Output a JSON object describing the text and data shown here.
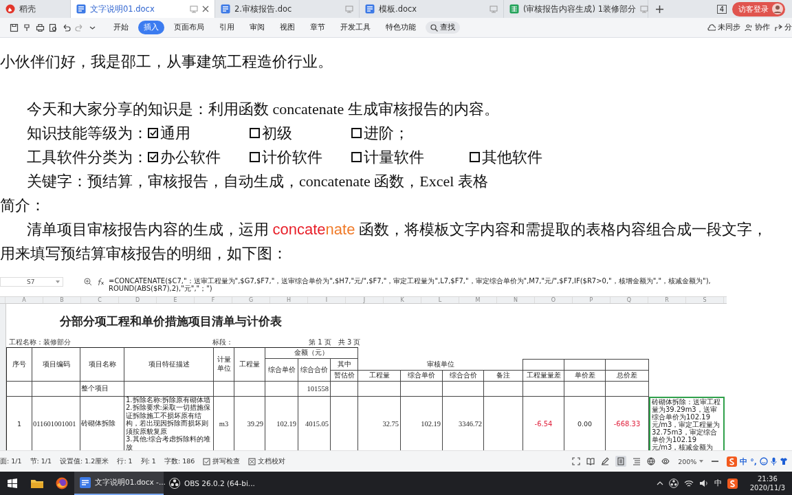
{
  "tabs": [
    {
      "label": "稻壳",
      "kind": "home",
      "selected": false
    },
    {
      "label": "文字说明01.docx",
      "kind": "doc",
      "selected": true
    },
    {
      "label": "2.审核报告.doc",
      "kind": "doc",
      "selected": false
    },
    {
      "label": "模板.docx",
      "kind": "doc",
      "selected": false
    },
    {
      "label": "(审核报告内容生成) 1装修部分",
      "kind": "sheet",
      "selected": false
    }
  ],
  "window_count": "4",
  "login": "访客登录",
  "menu": [
    {
      "label": "开始",
      "selected": false
    },
    {
      "label": "插入",
      "selected": true
    },
    {
      "label": "页面布局",
      "selected": false
    },
    {
      "label": "引用",
      "selected": false
    },
    {
      "label": "审阅",
      "selected": false
    },
    {
      "label": "视图",
      "selected": false
    },
    {
      "label": "章节",
      "selected": false
    },
    {
      "label": "开发工具",
      "selected": false
    },
    {
      "label": "特色功能",
      "selected": false
    }
  ],
  "search": "查找",
  "toolbar_right": [
    "未同步",
    "协作",
    "分"
  ],
  "document": [
    {
      "kind": "text",
      "indent": false,
      "segments": [
        {
          "text": "小伙伴们好，我是邵工，从事建筑工程造价行业。"
        }
      ]
    },
    {
      "kind": "text",
      "indent": true,
      "segments": [
        {
          "text": "今天和大家分享的知识是：利用函数 concatenate 生成审核报告的内容。"
        }
      ]
    },
    {
      "kind": "options",
      "indent": true,
      "label": "知识技能等级为：",
      "options": [
        {
          "label": "通用",
          "checked": true
        },
        {
          "label": "初级",
          "checked": false
        },
        {
          "label": "进阶；",
          "checked": false
        }
      ]
    },
    {
      "kind": "options",
      "indent": true,
      "label": "工具软件分类为：",
      "options": [
        {
          "label": "办公软件",
          "checked": true
        },
        {
          "label": "计价软件",
          "checked": false
        },
        {
          "label": "计量软件",
          "checked": false
        },
        {
          "label": "其他软件",
          "checked": false
        }
      ]
    },
    {
      "kind": "text",
      "indent": true,
      "segments": [
        {
          "text": "关键字：预结算，审核报告，自动生成，concatenate 函数，Excel 表格"
        }
      ]
    },
    {
      "kind": "text",
      "indent": false,
      "segments": [
        {
          "text": "简介："
        }
      ]
    },
    {
      "kind": "text",
      "indent": true,
      "segments": [
        {
          "text": "清单项目审核报告内容的生成，运用 "
        },
        {
          "text": "concate",
          "color": "#e8202a"
        },
        {
          "text": "nate",
          "color": "#f07a28"
        },
        {
          "text": " 函数，将模板文字内容和需提取的表格内容组合成一段文字，"
        }
      ]
    },
    {
      "kind": "text",
      "indent": false,
      "segments": [
        {
          "text": "用来填写预结算审核报告的明细，如下图："
        }
      ]
    }
  ],
  "sheet": {
    "cell_ref": "S7",
    "formula": "=CONCATENATE($C7,\"：送审工程量为\",$G7,$F7,\"，送审综合单价为\",$H7,\"元/\",$F7,\"，审定工程量为\",L7,$F7,\"，审定综合单价为\",M7,\"元/\",$F7,IF($R7>0,\"，核增金额为\",\"，核减金额为\"),ROUND(ABS($R7),2),\"元\",\"；\")",
    "column_letters": [
      "A",
      "B",
      "C",
      "D",
      "E",
      "F",
      "G",
      "H",
      "I",
      "J",
      "K",
      "L",
      "M",
      "N",
      "O",
      "P",
      "Q",
      "R",
      "S"
    ],
    "title": "分部分项工程和单价措施项目清单与计价表",
    "info": [
      "工程名称：装修部分",
      "标段：",
      "第 1 页　共 3 页"
    ],
    "headers": [
      "序号",
      "项目编码",
      "项目名称",
      "项目特征描述",
      "计量单位",
      "工程量",
      "金额（元）",
      "综合单价",
      "综合合价",
      "其中",
      "暂估价",
      "审核单位",
      "工程量",
      "综合单价",
      "综合合价",
      "备注",
      "工程量量差",
      "单价差",
      "总价差"
    ],
    "rows": [
      {
        "cells": [
          "",
          "",
          "整个项目",
          "",
          "",
          "",
          "",
          "101558",
          "",
          "",
          "",
          "",
          "",
          "",
          "",
          "",
          ""
        ]
      },
      {
        "cells": [
          "1",
          "011601001001",
          "砖砌体拆除",
          "1.拆除名称:拆除原有砌体墙\n2.拆除要求:采取一切措施保证拆除施工不损坏原有结构，若出现因拆除而损坏则须按原貌复原\n3.其他:综合考虑拆除料的堆放",
          "m3",
          "39.29",
          "102.19",
          "4015.05",
          "",
          "32.75",
          "102.19",
          "3346.72",
          "",
          {
            "text": "-6.54",
            "color": "#e0203c"
          },
          "0.00",
          {
            "text": "-668.33",
            "color": "#e0203c"
          },
          {
            "text": "砖砌体拆除：送审工程量为39.29m3，送审综合单价为102.19元/m3，审定工程量为32.75m3，审定综合单价为102.19元/m3，核减金额为",
            "selected": true
          }
        ]
      }
    ]
  },
  "status": [
    "面: 1/1",
    "节: 1/1",
    "设置值: 1.2厘米",
    "行: 1",
    "列: 1",
    "字数: 186"
  ],
  "status_checks": [
    "拼写检查",
    "文档校对"
  ],
  "zoom": "200%",
  "ime": [
    "中",
    "°,"
  ],
  "taskbar": [
    {
      "label": "文字说明01.docx -...",
      "kind": "word"
    },
    {
      "label": "OBS 26.0.2 (64-bi...",
      "kind": "obs"
    }
  ],
  "tray_lang": "中",
  "clock": {
    "time": "21:36",
    "date": "2020/11/3"
  }
}
